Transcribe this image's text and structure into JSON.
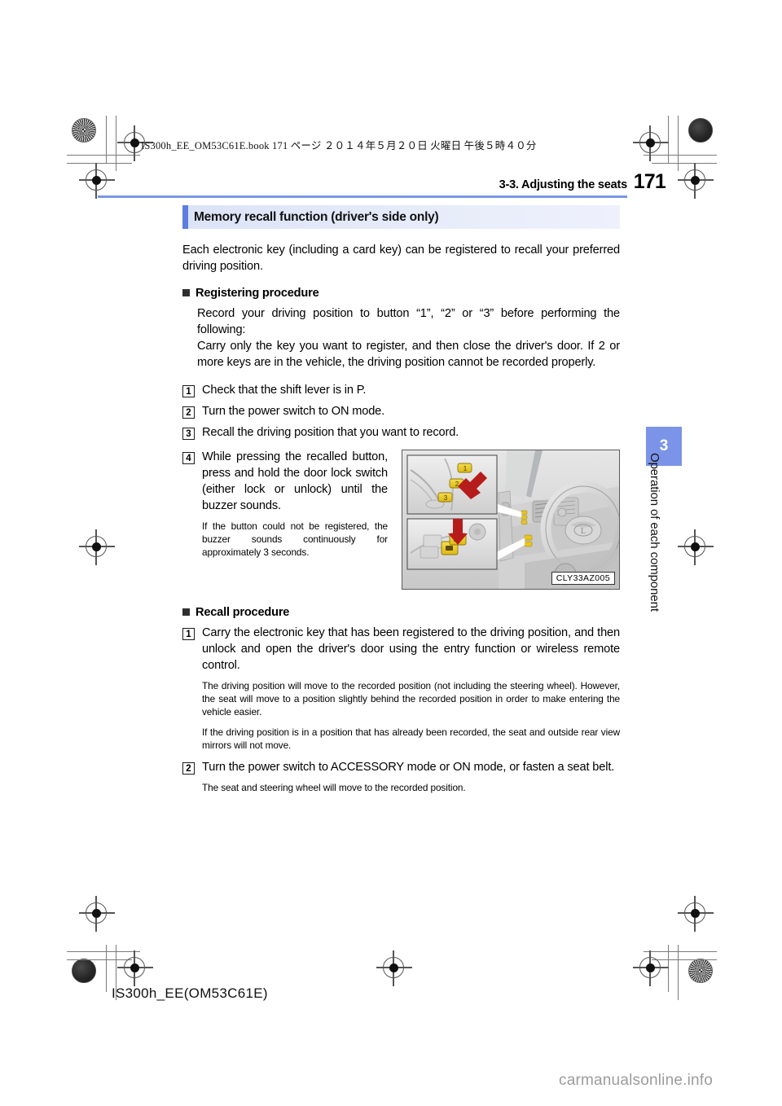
{
  "header": {
    "book_meta": "IS300h_EE_OM53C61E.book   171 ページ   ２０１４年５月２０日   火曜日   午後５時４０分",
    "running_head": "3-3. Adjusting the seats",
    "page_number": "171",
    "rule_color": "#7a96e8"
  },
  "chapter_tab": {
    "number": "3",
    "title": "Operation of each component",
    "tab_color": "#7b94e8"
  },
  "section": {
    "banner_title": "Memory recall function (driver's side only)",
    "banner_accent_color": "#5d7ee0",
    "intro": "Each electronic key (including a card key) can be registered to recall your preferred driving position."
  },
  "registering": {
    "heading": "Registering procedure",
    "preface_1": "Record your driving position to button “1”, “2” or “3” before performing the following:",
    "preface_2": "Carry only the key you want to register, and then close the driver's door. If 2 or more keys are in the vehicle, the driving position cannot be recorded properly.",
    "steps": [
      {
        "num": "1",
        "text": "Check that the shift lever is in P."
      },
      {
        "num": "2",
        "text": "Turn the power switch to ON mode."
      },
      {
        "num": "3",
        "text": "Recall the driving position that you want to record."
      },
      {
        "num": "4",
        "text": "While pressing the recalled button, press and hold the door lock switch (either lock or unlock) until the buzzer sounds."
      }
    ],
    "step4_note": "If the button could not be registered, the buzzer sounds continuously for approximately 3 seconds."
  },
  "figure": {
    "caption": "CLY33AZ005",
    "alt_name": "door-memory-buttons-and-lock-switch-illustration",
    "highlight_color": "#e8c420",
    "arrow_color": "#b71c1c",
    "memory_button_labels": [
      "1",
      "2",
      "3"
    ]
  },
  "recall": {
    "heading": "Recall procedure",
    "steps": [
      {
        "num": "1",
        "text": "Carry the electronic key that has been registered to the driving position, and then unlock and open the driver's door using the entry function or wireless remote control.",
        "notes": [
          "The driving position will move to the recorded position (not including the steering wheel). However, the seat will move to a position slightly behind the recorded position in order to make entering the vehicle easier.",
          "If the driving position is in a position that has already been recorded, the seat and outside rear view mirrors will not move."
        ]
      },
      {
        "num": "2",
        "text": "Turn the power switch to ACCESSORY mode or ON mode, or fasten a seat belt.",
        "notes": [
          "The seat and steering wheel will move to the recorded position."
        ]
      }
    ]
  },
  "footer": {
    "code": "IS300h_EE(OM53C61E)",
    "watermark": "carmanualsonline.info"
  }
}
